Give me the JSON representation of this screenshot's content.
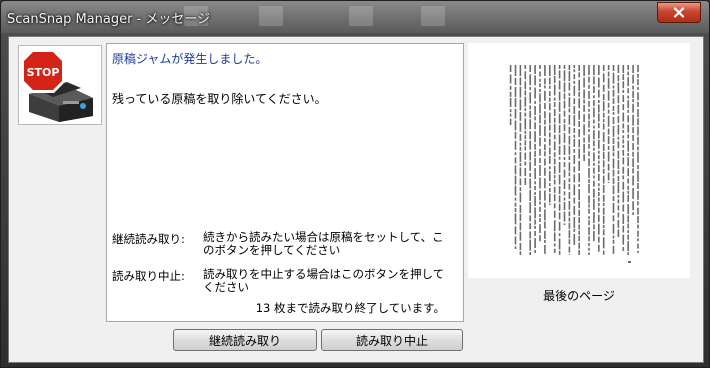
{
  "window": {
    "title": "ScanSnap Manager - メッセージ"
  },
  "message": {
    "title": "原稿ジャムが発生しました。",
    "body": "残っている原稿を取り除いてください。"
  },
  "options": [
    {
      "label": "継続読み取り:",
      "description": "続きから読みたい場合は原稿をセットして、このボタンを押してください"
    },
    {
      "label": "読み取り中止:",
      "description": "読み取りを中止する場合はこのボタンを押してください"
    }
  ],
  "status": "13 枚まで読み取り終了しています。",
  "buttons": {
    "continue_label": "継続読み取り",
    "stop_label": "読み取り中止"
  },
  "preview": {
    "caption": "最後のページ"
  },
  "icons": {
    "stop": "stop-sign-scanner-icon",
    "close": "close-icon"
  },
  "colors": {
    "stop_red": "#d42418",
    "message_title": "#1a3a9a"
  }
}
